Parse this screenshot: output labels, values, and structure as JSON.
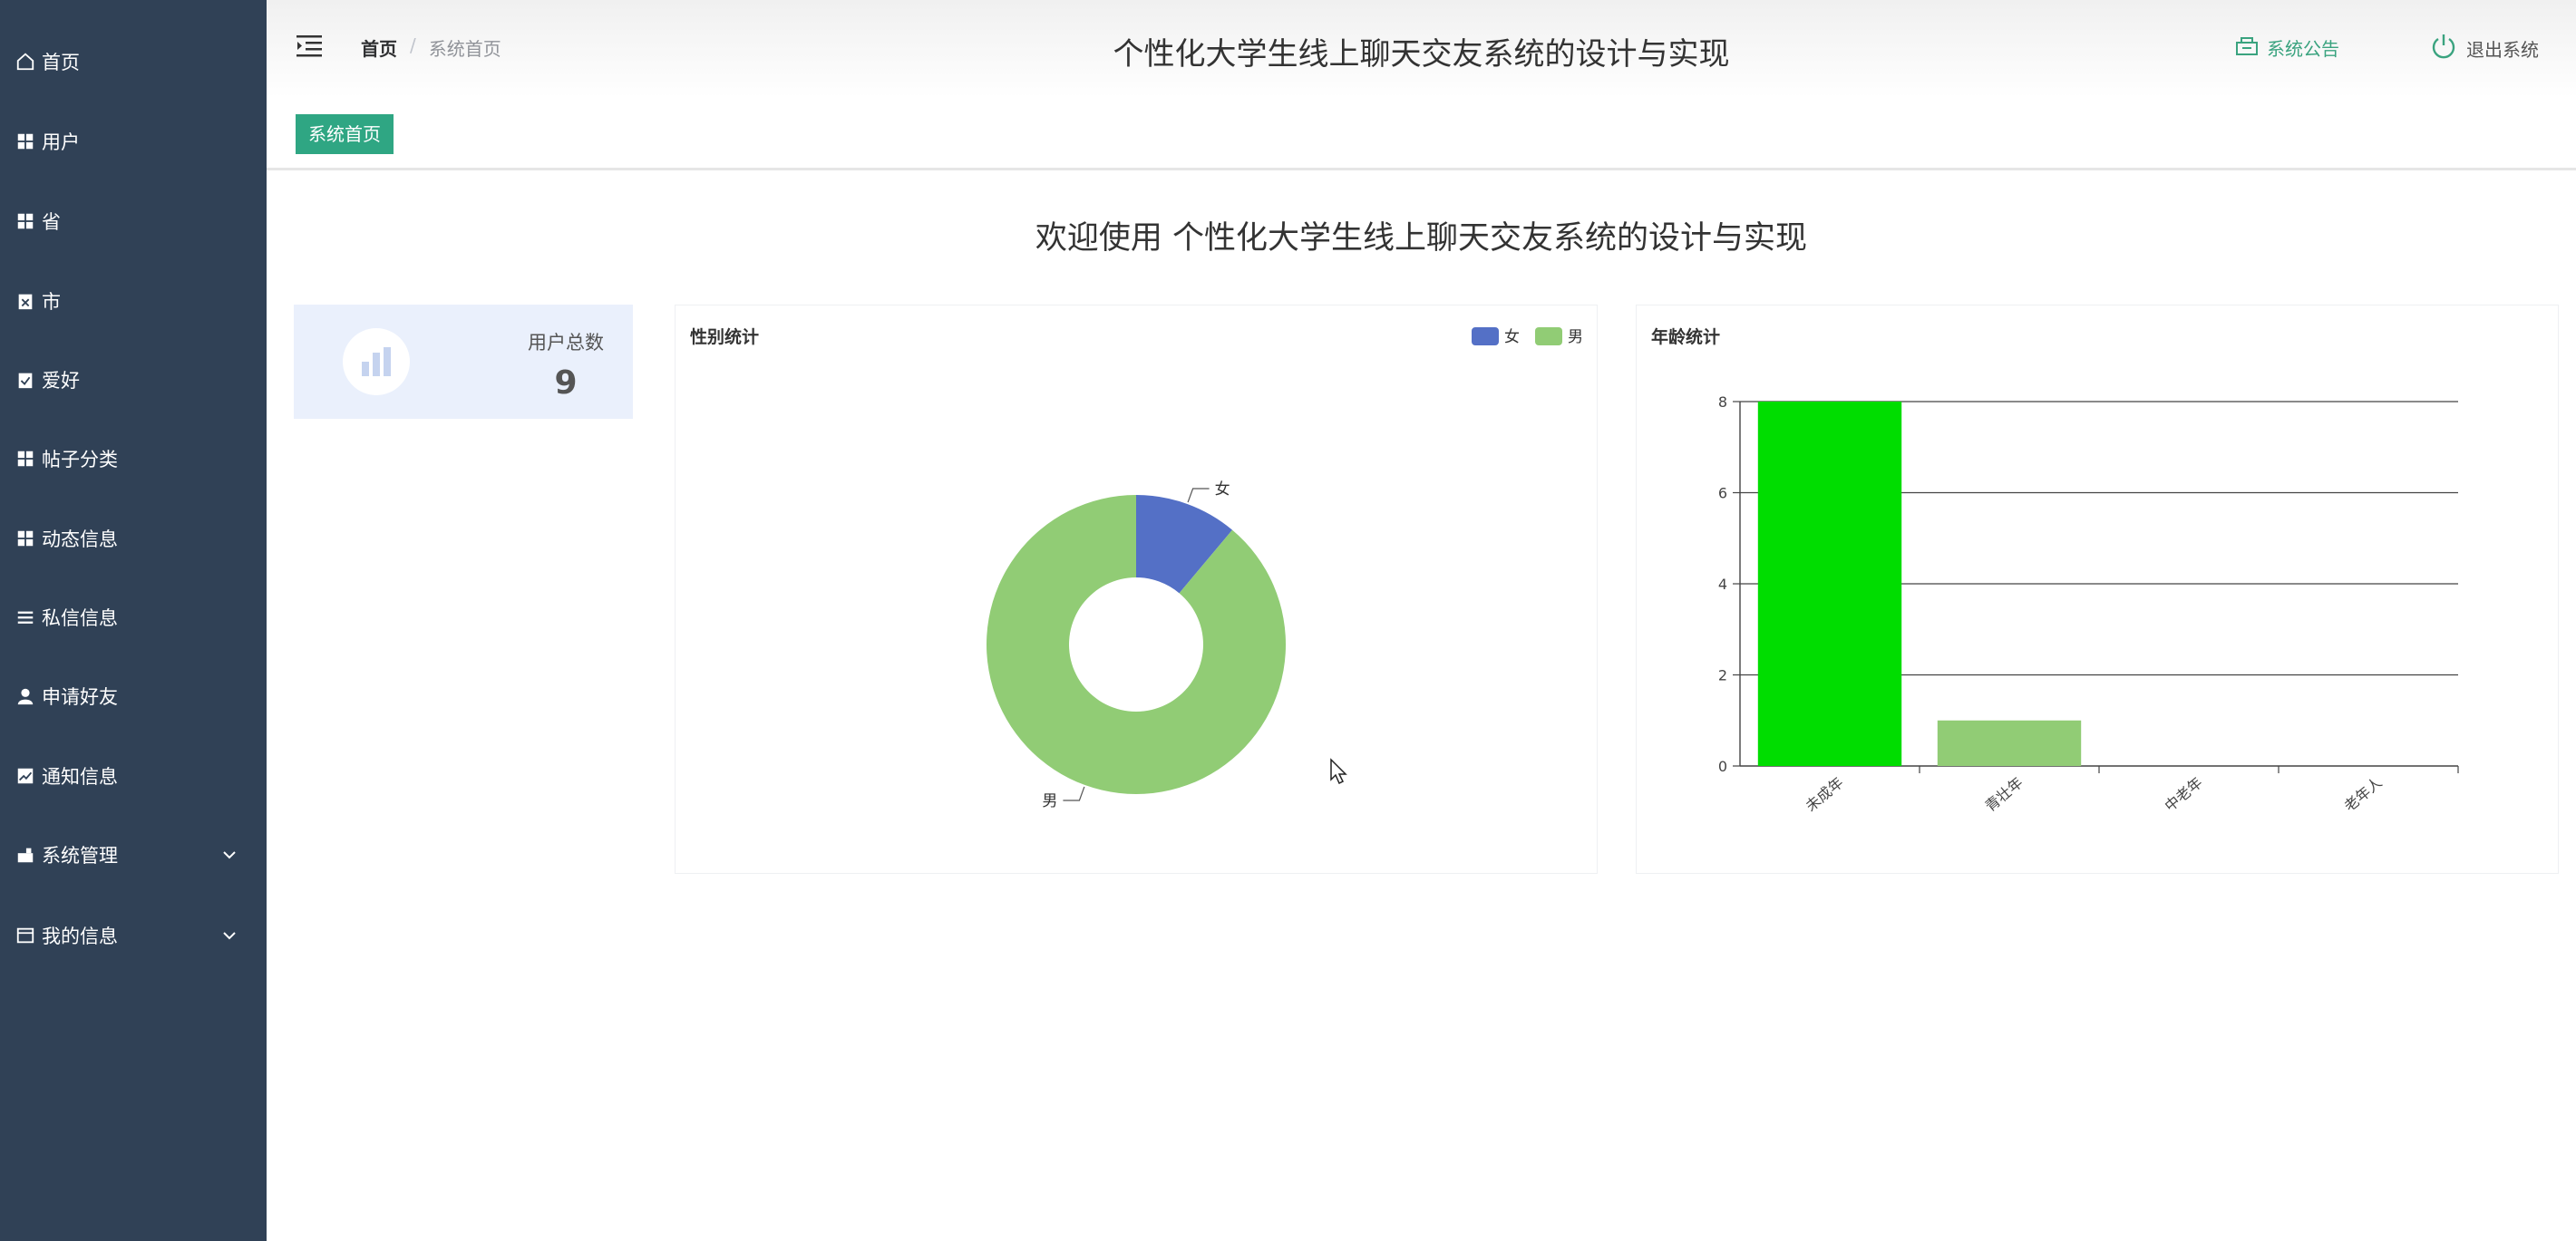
{
  "sidebar": {
    "items": [
      {
        "label": "首页",
        "icon": "home-icon"
      },
      {
        "label": "用户",
        "icon": "grid-icon"
      },
      {
        "label": "省",
        "icon": "grid-icon"
      },
      {
        "label": "市",
        "icon": "clipboard-x-icon"
      },
      {
        "label": "爱好",
        "icon": "clipboard-check-icon"
      },
      {
        "label": "帖子分类",
        "icon": "grid-icon"
      },
      {
        "label": "动态信息",
        "icon": "grid-icon"
      },
      {
        "label": "私信信息",
        "icon": "list-icon"
      },
      {
        "label": "申请好友",
        "icon": "user-icon"
      },
      {
        "label": "通知信息",
        "icon": "chart-icon"
      },
      {
        "label": "系统管理",
        "icon": "settings-icon"
      },
      {
        "label": "我的信息",
        "icon": "card-icon"
      }
    ]
  },
  "header": {
    "breadcrumb_home": "首页",
    "breadcrumb_sep": "/",
    "breadcrumb_current": "系统首页",
    "title": "个性化大学生线上聊天交友系统的设计与实现",
    "notice": "系统公告",
    "logout": "退出系统"
  },
  "tags": {
    "active": "系统首页"
  },
  "welcome": "欢迎使用 个性化大学生线上聊天交友系统的设计与实现",
  "stat": {
    "label": "用户总数",
    "value": "9"
  },
  "gender_panel": {
    "title": "性别统计"
  },
  "age_panel": {
    "title": "年龄统计"
  },
  "chart_data": [
    {
      "type": "pie",
      "title": "性别统计",
      "donut": true,
      "legend_position": "top-right",
      "categories": [
        "女",
        "男"
      ],
      "values": [
        1,
        8
      ],
      "colors": [
        "#5470c6",
        "#91cc75"
      ]
    },
    {
      "type": "bar",
      "title": "年龄统计",
      "categories": [
        "未成年",
        "青壮年",
        "中老年",
        "老年人"
      ],
      "values": [
        8,
        1,
        0,
        0
      ],
      "colors": [
        "#00dd00",
        "#91cc75",
        "#91cc75",
        "#91cc75"
      ],
      "ylim": [
        0,
        8
      ],
      "yticks": [
        0,
        2,
        4,
        6,
        8
      ],
      "grid": true
    }
  ]
}
